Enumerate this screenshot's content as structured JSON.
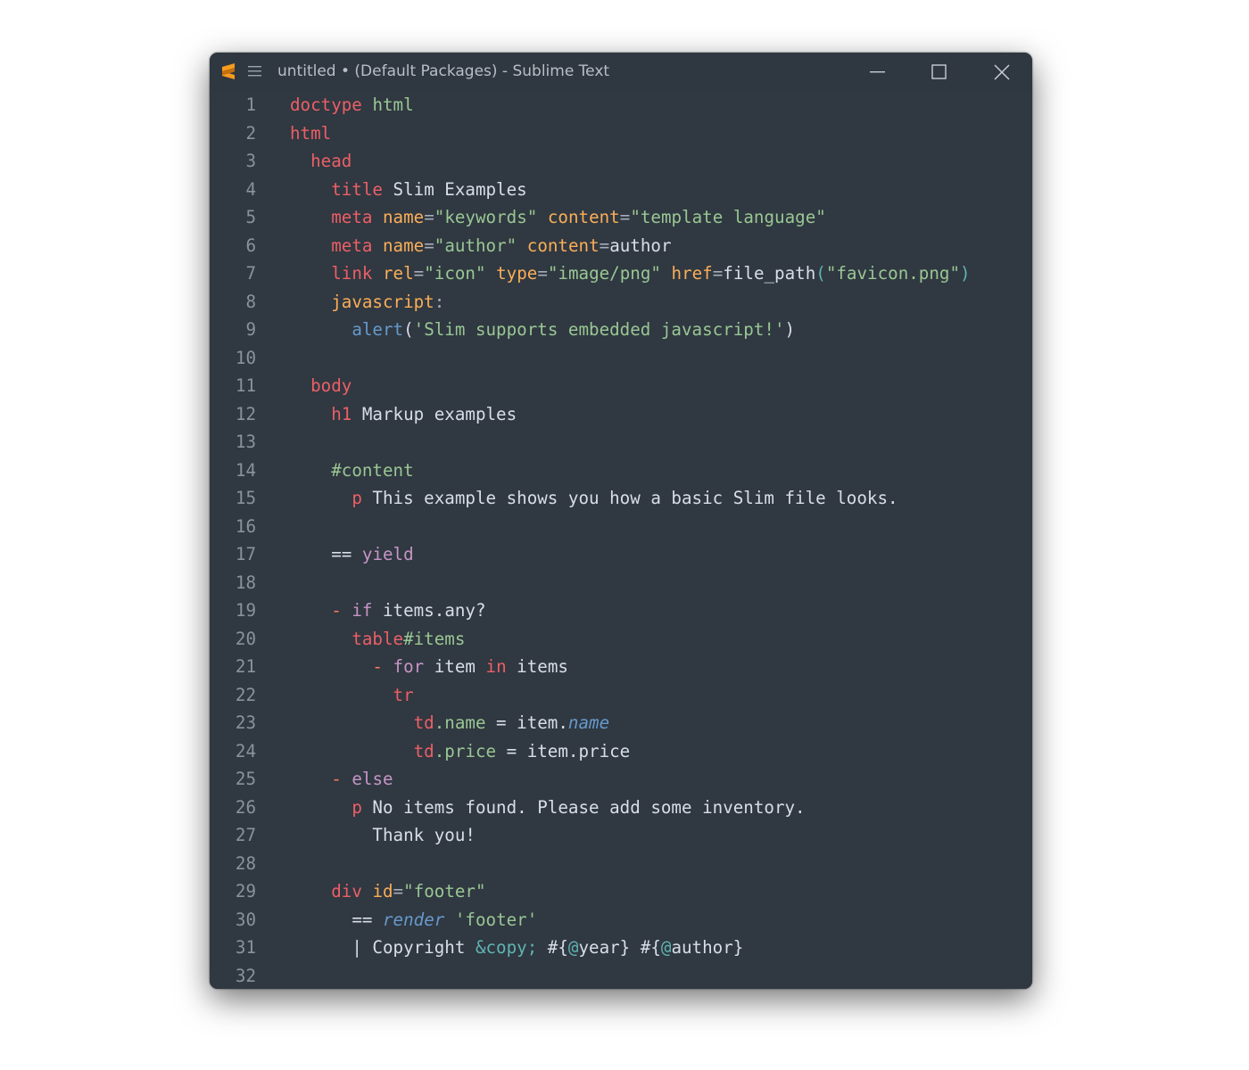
{
  "window": {
    "title": "untitled • (Default Packages) - Sublime Text",
    "app_icon": "sublime-text-logo-icon",
    "menu_icon": "hamburger-menu-icon",
    "controls": [
      "minimize-icon",
      "maximize-icon",
      "close-icon"
    ]
  },
  "colors": {
    "editor_bg": "#303841",
    "tag": "#ec5f66",
    "string": "#99c794",
    "keyword": "#c695c6",
    "function": "#6699cc",
    "text": "#d8dee9",
    "line_number": "#8a929c"
  },
  "editor": {
    "lines": [
      {
        "n": "1",
        "tokens": [
          [
            "t-tag",
            "doctype"
          ],
          [
            "t-pl",
            " "
          ],
          [
            "t-str",
            "html"
          ]
        ]
      },
      {
        "n": "2",
        "tokens": [
          [
            "t-tag",
            "html"
          ]
        ]
      },
      {
        "n": "3",
        "tokens": [
          [
            "t-pl",
            "  "
          ],
          [
            "t-tag",
            "head"
          ]
        ]
      },
      {
        "n": "4",
        "tokens": [
          [
            "t-pl",
            "    "
          ],
          [
            "t-tag",
            "title"
          ],
          [
            "t-pl",
            " Slim Examples"
          ]
        ]
      },
      {
        "n": "5",
        "tokens": [
          [
            "t-pl",
            "    "
          ],
          [
            "t-tag",
            "meta"
          ],
          [
            "t-pl",
            " "
          ],
          [
            "t-attr",
            "name"
          ],
          [
            "t-punc",
            "="
          ],
          [
            "t-str",
            "\"keywords\""
          ],
          [
            "t-pl",
            " "
          ],
          [
            "t-attr",
            "content"
          ],
          [
            "t-punc",
            "="
          ],
          [
            "t-str",
            "\"template language\""
          ]
        ]
      },
      {
        "n": "6",
        "tokens": [
          [
            "t-pl",
            "    "
          ],
          [
            "t-tag",
            "meta"
          ],
          [
            "t-pl",
            " "
          ],
          [
            "t-attr",
            "name"
          ],
          [
            "t-punc",
            "="
          ],
          [
            "t-str",
            "\"author\""
          ],
          [
            "t-pl",
            " "
          ],
          [
            "t-attr",
            "content"
          ],
          [
            "t-punc",
            "="
          ],
          [
            "t-pl",
            "author"
          ]
        ]
      },
      {
        "n": "7",
        "tokens": [
          [
            "t-pl",
            "    "
          ],
          [
            "t-tag",
            "link"
          ],
          [
            "t-pl",
            " "
          ],
          [
            "t-attr",
            "rel"
          ],
          [
            "t-punc",
            "="
          ],
          [
            "t-str",
            "\"icon\""
          ],
          [
            "t-pl",
            " "
          ],
          [
            "t-attr",
            "type"
          ],
          [
            "t-punc",
            "="
          ],
          [
            "t-str",
            "\"image/png\""
          ],
          [
            "t-pl",
            " "
          ],
          [
            "t-attr",
            "href"
          ],
          [
            "t-punc",
            "="
          ],
          [
            "t-pl",
            "file_path"
          ],
          [
            "t-ent",
            "("
          ],
          [
            "t-str",
            "\"favicon.png\""
          ],
          [
            "t-ent",
            ")"
          ]
        ]
      },
      {
        "n": "8",
        "tokens": [
          [
            "t-pl",
            "    "
          ],
          [
            "t-attr",
            "javascript"
          ],
          [
            "t-punc",
            ":"
          ]
        ]
      },
      {
        "n": "9",
        "tokens": [
          [
            "t-pl",
            "      "
          ],
          [
            "t-fn",
            "alert"
          ],
          [
            "t-pl",
            "("
          ],
          [
            "t-str",
            "'Slim supports embedded javascript!'"
          ],
          [
            "t-pl",
            ")"
          ]
        ]
      },
      {
        "n": "10",
        "tokens": []
      },
      {
        "n": "11",
        "tokens": [
          [
            "t-pl",
            "  "
          ],
          [
            "t-tag",
            "body"
          ]
        ]
      },
      {
        "n": "12",
        "tokens": [
          [
            "t-pl",
            "    "
          ],
          [
            "t-tag",
            "h1"
          ],
          [
            "t-pl",
            " Markup examples"
          ]
        ]
      },
      {
        "n": "13",
        "tokens": []
      },
      {
        "n": "14",
        "tokens": [
          [
            "t-pl",
            "    "
          ],
          [
            "t-id",
            "#content"
          ]
        ]
      },
      {
        "n": "15",
        "tokens": [
          [
            "t-pl",
            "      "
          ],
          [
            "t-tag",
            "p"
          ],
          [
            "t-pl",
            " This example shows you how a basic Slim file looks."
          ]
        ]
      },
      {
        "n": "16",
        "tokens": []
      },
      {
        "n": "17",
        "tokens": [
          [
            "t-pl",
            "    "
          ],
          [
            "t-pl",
            "=="
          ],
          [
            "t-pl",
            " "
          ],
          [
            "t-kw",
            "yield"
          ]
        ]
      },
      {
        "n": "18",
        "tokens": []
      },
      {
        "n": "19",
        "tokens": [
          [
            "t-pl",
            "    "
          ],
          [
            "t-op",
            "-"
          ],
          [
            "t-pl",
            " "
          ],
          [
            "t-kw",
            "if"
          ],
          [
            "t-pl",
            " items.any?"
          ]
        ]
      },
      {
        "n": "20",
        "tokens": [
          [
            "t-pl",
            "      "
          ],
          [
            "t-tag",
            "table"
          ],
          [
            "t-id",
            "#items"
          ]
        ]
      },
      {
        "n": "21",
        "tokens": [
          [
            "t-pl",
            "        "
          ],
          [
            "t-op",
            "-"
          ],
          [
            "t-pl",
            " "
          ],
          [
            "t-kw",
            "for"
          ],
          [
            "t-pl",
            " item "
          ],
          [
            "t-tag",
            "in"
          ],
          [
            "t-pl",
            " items"
          ]
        ]
      },
      {
        "n": "22",
        "tokens": [
          [
            "t-pl",
            "          "
          ],
          [
            "t-tag",
            "tr"
          ]
        ]
      },
      {
        "n": "23",
        "tokens": [
          [
            "t-pl",
            "            "
          ],
          [
            "t-tag",
            "td"
          ],
          [
            "t-cls",
            ".name"
          ],
          [
            "t-pl",
            " = item."
          ],
          [
            "t-ital",
            "name"
          ]
        ]
      },
      {
        "n": "24",
        "tokens": [
          [
            "t-pl",
            "            "
          ],
          [
            "t-tag",
            "td"
          ],
          [
            "t-cls",
            ".price"
          ],
          [
            "t-pl",
            " = item.price"
          ]
        ]
      },
      {
        "n": "25",
        "tokens": [
          [
            "t-pl",
            "    "
          ],
          [
            "t-op",
            "-"
          ],
          [
            "t-pl",
            " "
          ],
          [
            "t-kw",
            "else"
          ]
        ]
      },
      {
        "n": "26",
        "tokens": [
          [
            "t-pl",
            "      "
          ],
          [
            "t-tag",
            "p"
          ],
          [
            "t-pl",
            " No items found. Please add some inventory."
          ]
        ]
      },
      {
        "n": "27",
        "tokens": [
          [
            "t-pl",
            "        Thank you!"
          ]
        ]
      },
      {
        "n": "28",
        "tokens": []
      },
      {
        "n": "29",
        "tokens": [
          [
            "t-pl",
            "    "
          ],
          [
            "t-tag",
            "div"
          ],
          [
            "t-pl",
            " "
          ],
          [
            "t-attr",
            "id"
          ],
          [
            "t-punc",
            "="
          ],
          [
            "t-str",
            "\"footer\""
          ]
        ]
      },
      {
        "n": "30",
        "tokens": [
          [
            "t-pl",
            "      "
          ],
          [
            "t-pl",
            "=="
          ],
          [
            "t-pl",
            " "
          ],
          [
            "t-ital",
            "render"
          ],
          [
            "t-pl",
            " "
          ],
          [
            "t-str",
            "'footer'"
          ]
        ]
      },
      {
        "n": "31",
        "tokens": [
          [
            "t-pl",
            "      "
          ],
          [
            "t-pl",
            "| Copyright "
          ],
          [
            "t-ent",
            "&copy;"
          ],
          [
            "t-pl",
            " #{"
          ],
          [
            "t-at",
            "@"
          ],
          [
            "t-pl",
            "year} #{"
          ],
          [
            "t-at",
            "@"
          ],
          [
            "t-pl",
            "author}"
          ]
        ]
      },
      {
        "n": "32",
        "tokens": []
      }
    ]
  }
}
